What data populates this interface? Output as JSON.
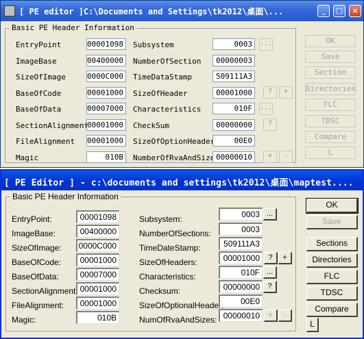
{
  "window1": {
    "title": "[ PE editor ]C:\\Documents and Settings\\tk2012\\桌面\\...",
    "caption_buttons": [
      "_",
      "□",
      "×"
    ],
    "group_title": "Basic PE Header Information",
    "left_fields": [
      {
        "label": "EntryPoint",
        "value": "00001098"
      },
      {
        "label": "ImageBase",
        "value": "00400000"
      },
      {
        "label": "SizeOfImage",
        "value": "0000C000"
      },
      {
        "label": "BaseOfCode",
        "value": "00001000"
      },
      {
        "label": "BaseOfData",
        "value": "00007000"
      },
      {
        "label": "SectionAlignment",
        "value": "00001000"
      },
      {
        "label": "FileAlignment",
        "value": "00001000"
      },
      {
        "label": "Magic",
        "value": "010B"
      }
    ],
    "right_fields": [
      {
        "label": "Subsystem",
        "value": "0003"
      },
      {
        "label": "NumberOfSection",
        "value": "00000003"
      },
      {
        "label": "TimeDataStamp",
        "value": "509111A3"
      },
      {
        "label": "SizeOfHeader",
        "value": "00001000"
      },
      {
        "label": "Characteristics",
        "value": "010F"
      },
      {
        "label": "CheckSum",
        "value": "00000000"
      },
      {
        "label": "SizeOfOptionHeader",
        "value": "00E0"
      },
      {
        "label": "NumberOfRvaAndSize",
        "value": "00000010"
      }
    ],
    "small_buttons": {
      "dots": "...",
      "question": "?",
      "plus": "+",
      "minus": "-"
    },
    "right_buttons": [
      "OK",
      "Save",
      "Section",
      "Directories",
      "FLC",
      "TDSC",
      "Compare",
      "L"
    ]
  },
  "window2": {
    "title": "[ PE Editor ] - c:\\documents and settings\\tk2012\\桌面\\maptest....",
    "group_title": "Basic PE Header Information",
    "left_fields": [
      {
        "label": "EntryPoint:",
        "value": "00001098"
      },
      {
        "label": "ImageBase:",
        "value": "00400000"
      },
      {
        "label": "SizeOfImage:",
        "value": "0000C000"
      },
      {
        "label": "BaseOfCode:",
        "value": "00001000"
      },
      {
        "label": "BaseOfData:",
        "value": "00007000"
      },
      {
        "label": "SectionAlignment:",
        "value": "00001000"
      },
      {
        "label": "FileAlignment:",
        "value": "00001000"
      },
      {
        "label": "Magic:",
        "value": "010B"
      }
    ],
    "right_fields": [
      {
        "label": "Subsystem:",
        "value": "0003"
      },
      {
        "label": "NumberOfSections:",
        "value": "0003"
      },
      {
        "label": "TimeDateStamp:",
        "value": "509111A3"
      },
      {
        "label": "SizeOfHeaders:",
        "value": "00001000"
      },
      {
        "label": "Characteristics:",
        "value": "010F"
      },
      {
        "label": "Checksum:",
        "value": "00000000"
      },
      {
        "label": "SizeOfOptionalHeader:",
        "value": "00E0"
      },
      {
        "label": "NumOfRvaAndSizes:",
        "value": "00000010"
      }
    ],
    "small_buttons": {
      "dots": "...",
      "question": "?",
      "plus": "+",
      "minus": "-"
    },
    "right_buttons": [
      "OK",
      "Save",
      "Sections",
      "Directories",
      "FLC",
      "TDSC",
      "Compare"
    ],
    "l_button": "L"
  }
}
